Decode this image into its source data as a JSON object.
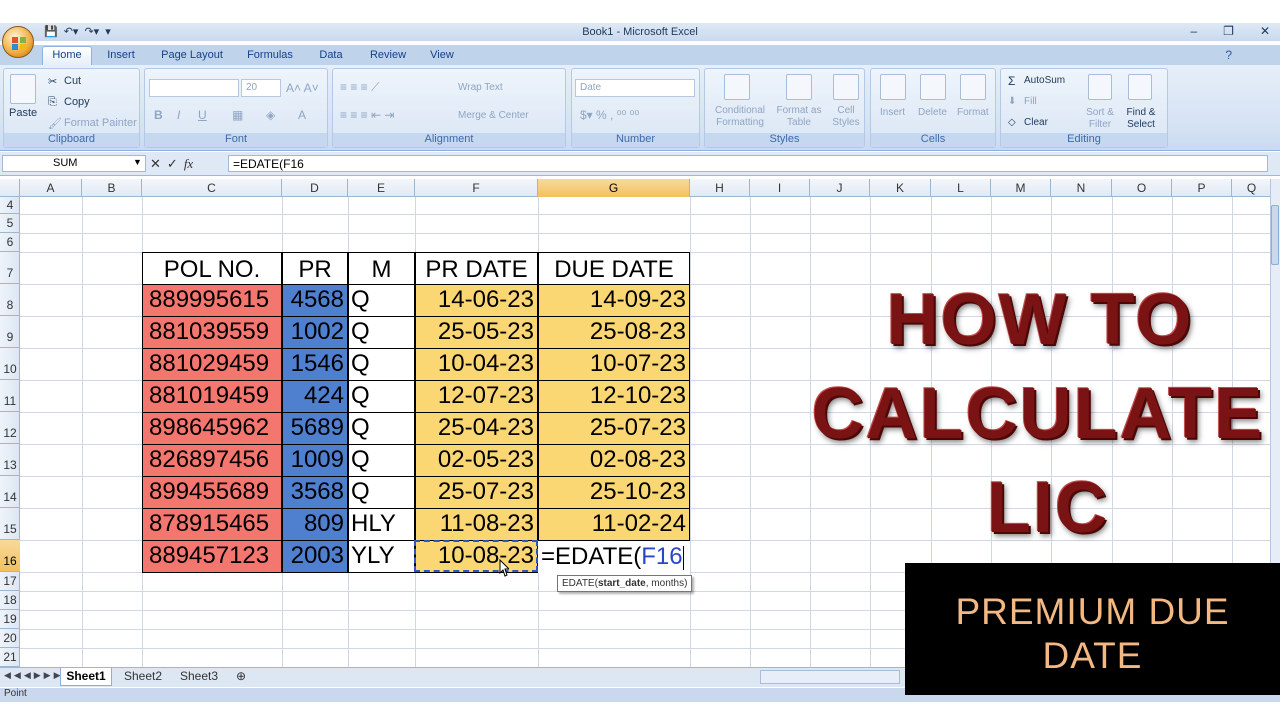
{
  "window": {
    "title": "Book1 - Microsoft Excel",
    "controls": [
      "–",
      "❐",
      "✕"
    ]
  },
  "tabs": [
    "Home",
    "Insert",
    "Page Layout",
    "Formulas",
    "Data",
    "Review",
    "View"
  ],
  "ribbon": {
    "clipboard": {
      "label": "Clipboard",
      "paste": "Paste",
      "cut": "Cut",
      "copy": "Copy",
      "format_painter": "Format Painter"
    },
    "font": {
      "label": "Font",
      "size": "20"
    },
    "alignment": {
      "label": "Alignment",
      "wrap": "Wrap Text",
      "merge": "Merge & Center"
    },
    "number": {
      "label": "Number",
      "format": "Date"
    },
    "styles": {
      "label": "Styles",
      "conditional": "Conditional Formatting",
      "format_table": "Format as Table",
      "cell_styles": "Cell Styles"
    },
    "cells": {
      "label": "Cells",
      "insert": "Insert",
      "delete": "Delete",
      "format": "Format"
    },
    "editing": {
      "label": "Editing",
      "autosum": "AutoSum",
      "fill": "Fill",
      "clear": "Clear",
      "sort": "Sort & Filter",
      "find": "Find & Select"
    }
  },
  "formula_bar": {
    "name_box": "SUM",
    "formula": "=EDATE(F16"
  },
  "columns": [
    "A",
    "B",
    "C",
    "D",
    "E",
    "F",
    "G",
    "H",
    "I",
    "J",
    "K",
    "L",
    "M",
    "N",
    "O",
    "P",
    "Q"
  ],
  "rows": [
    "4",
    "5",
    "6",
    "7",
    "8",
    "9",
    "10",
    "11",
    "12",
    "13",
    "14",
    "15",
    "16",
    "17",
    "18",
    "19",
    "20",
    "21"
  ],
  "table": {
    "headers": [
      "POL NO.",
      "PR",
      "M",
      "PR DATE",
      "DUE DATE"
    ],
    "rows": [
      [
        "889995615",
        "4568",
        "Q",
        "14-06-23",
        "14-09-23"
      ],
      [
        "881039559",
        "1002",
        "Q",
        "25-05-23",
        "25-08-23"
      ],
      [
        "881029459",
        "1546",
        "Q",
        "10-04-23",
        "10-07-23"
      ],
      [
        "881019459",
        "424",
        "Q",
        "12-07-23",
        "12-10-23"
      ],
      [
        "898645962",
        "5689",
        "Q",
        "25-04-23",
        "25-07-23"
      ],
      [
        "826897456",
        "1009",
        "Q",
        "02-05-23",
        "02-08-23"
      ],
      [
        "899455689",
        "3568",
        "Q",
        "25-07-23",
        "25-10-23"
      ],
      [
        "878915465",
        "809",
        "HLY",
        "11-08-23",
        "11-02-24"
      ],
      [
        "889457123",
        "2003",
        "YLY",
        "10-08-23",
        ""
      ]
    ]
  },
  "editing_cell": {
    "prefix": "=EDATE(",
    "ref": "F16"
  },
  "tooltip": {
    "fn": "EDATE(",
    "arg1": "start_date",
    "rest": ", months)"
  },
  "sheets": [
    "Sheet1",
    "Sheet2",
    "Sheet3"
  ],
  "status": "Point",
  "overlay": {
    "line1": "HOW TO",
    "line2": "CALCULATE",
    "line3": "LIC",
    "premium": "PREMIUM DUE DATE"
  }
}
